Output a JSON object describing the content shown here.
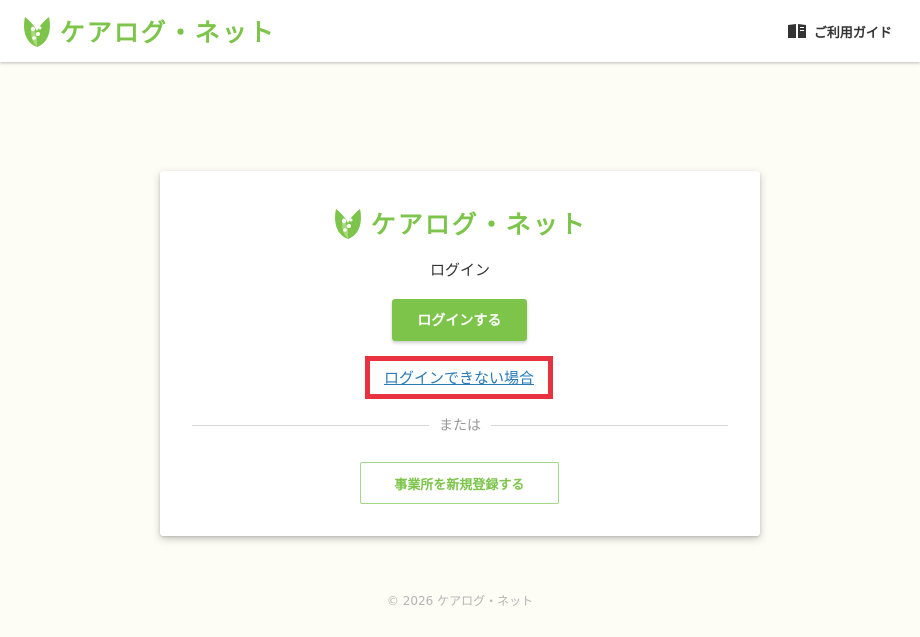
{
  "header": {
    "brand": "ケアログ・ネット",
    "guide_label": "ご利用ガイド",
    "guide_icon": "book-icon"
  },
  "card": {
    "brand": "ケアログ・ネット",
    "heading": "ログイン",
    "login_button": "ログインする",
    "help_link": "ログインできない場合",
    "divider_text": "または",
    "register_button": "事業所を新規登録する"
  },
  "footer": {
    "copyright": "© 2026 ケアログ・ネット"
  },
  "colors": {
    "brand_green": "#7cc44a",
    "highlight_red": "#e8323f",
    "link_blue": "#2a7ab8",
    "page_bg": "#fdfcf5"
  }
}
